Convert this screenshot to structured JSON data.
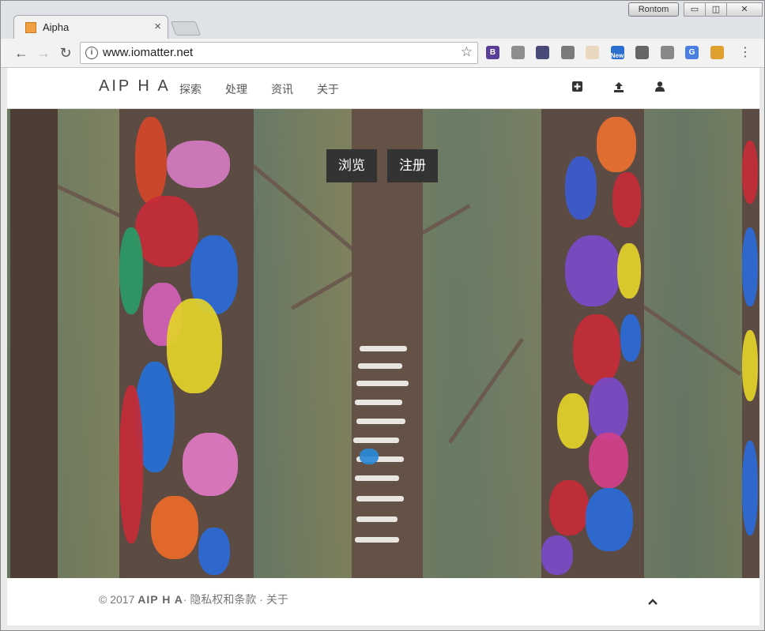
{
  "browser": {
    "tab_title": "Aipha",
    "tab_close": "×",
    "user_chip": "Rontom",
    "url": "www.iomatter.net",
    "extensions": [
      {
        "name": "bootstrap-icon",
        "label": "B",
        "color": "#5b3e96"
      },
      {
        "name": "globe-icon",
        "label": "",
        "color": "#8d8d8d"
      },
      {
        "name": "eyedropper-icon",
        "label": "",
        "color": "#4a4a7a"
      },
      {
        "name": "vue-icon",
        "label": "",
        "color": "#7a7a7a"
      },
      {
        "name": "notes-icon",
        "label": "",
        "color": "#e8d8c0"
      },
      {
        "name": "news-icon",
        "label": "New",
        "color": "#2a6fd0"
      },
      {
        "name": "chat-icon",
        "label": "",
        "color": "#666"
      },
      {
        "name": "edit-icon",
        "label": "",
        "color": "#888"
      },
      {
        "name": "translate-icon",
        "label": "G",
        "color": "#4a7ee0"
      },
      {
        "name": "sync-icon",
        "label": "",
        "color": "#e0a030"
      }
    ]
  },
  "site": {
    "brand": "AIP H A",
    "nav": [
      "探索",
      "处理",
      "资讯",
      "关于"
    ],
    "hero_buttons": [
      "浏览",
      "注册"
    ],
    "footer_year": "© 2017",
    "footer_brand": "AIP H A",
    "footer_links": "· 隐私权和条款 · 关于",
    "scroll_top": "⌃"
  },
  "colors": {
    "accent": "#333333",
    "page_bg": "#ffffff"
  }
}
